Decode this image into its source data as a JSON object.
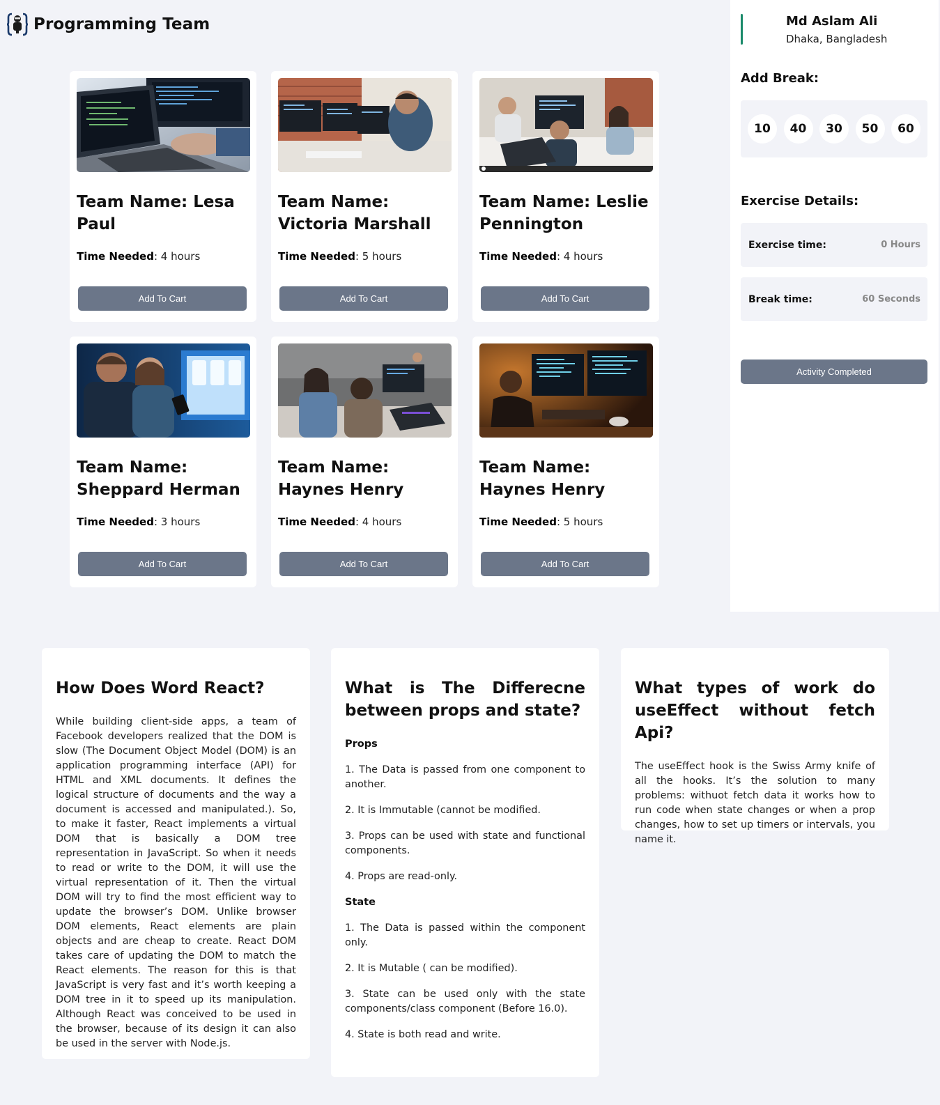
{
  "header": {
    "title": "Programming Team",
    "logo_icon": "bracket-robot-logo-icon"
  },
  "cards": [
    {
      "title": "Team Name: Lesa Paul",
      "time_label": "Time Needed",
      "time_value": ": 4 hours",
      "button": "Add To Cart",
      "image": "laptop-coding-photo"
    },
    {
      "title": "Team Name: Victoria Marshall",
      "time_label": "Time Needed",
      "time_value": ": 5 hours",
      "button": "Add To Cart",
      "image": "developer-monitors-photo"
    },
    {
      "title": "Team Name: Leslie Pennington",
      "time_label": "Time Needed",
      "time_value": ": 4 hours",
      "button": "Add To Cart",
      "image": "team-meeting-photo"
    },
    {
      "title": "Team Name: Sheppard Herman",
      "time_label": "Time Needed",
      "time_value": ": 3 hours",
      "button": "Add To Cart",
      "image": "app-design-photo"
    },
    {
      "title": "Team Name: Haynes Henry",
      "time_label": "Time Needed",
      "time_value": ": 4 hours",
      "button": "Add To Cart",
      "image": "office-coworkers-photo"
    },
    {
      "title": "Team Name: Haynes Henry",
      "time_label": "Time Needed",
      "time_value": ": 5 hours",
      "button": "Add To Cart",
      "image": "night-coding-photo"
    }
  ],
  "sidebar": {
    "name": "Md Aslam Ali",
    "location": "Dhaka, Bangladesh",
    "add_break_title": "Add Break:",
    "breaks": [
      "10",
      "40",
      "30",
      "50",
      "60"
    ],
    "exercise_title": "Exercise Details:",
    "exercise_time_label": "Exercise time:",
    "exercise_time_value": "0 Hours",
    "break_time_label": "Break time:",
    "break_time_value": "60 Seconds",
    "completed_button": "Activity Completed"
  },
  "qa": {
    "q1": {
      "title": "How Does Word React?",
      "body": "While building client-side apps, a team of Facebook developers realized that the DOM is slow (The Document Object Model (DOM) is an application programming interface (API) for HTML and XML documents. It defines the logical structure of documents and the way a document is accessed and manipulated.). So, to make it faster, React implements a virtual DOM that is basically a DOM tree representation in JavaScript. So when it needs to read or write to the DOM, it will use the virtual representation of it. Then the virtual DOM will try to find the most efficient way to update the browser’s DOM. Unlike browser DOM elements, React elements are plain objects and are cheap to create. React DOM takes care of updating the DOM to match the React elements. The reason for this is that JavaScript is very fast and it’s worth keeping a DOM tree in it to speed up its manipulation. Although React was conceived to be used in the browser, because of its design it can also be used in the server with Node.js."
    },
    "q2": {
      "title": "What is The Differecne between props and state?",
      "props_head": "Props",
      "props": [
        "1. The Data is passed from one component to another.",
        "2. It is Immutable (cannot be modified.",
        "3. Props can be used with state and functional components.",
        "4. Props are read-only."
      ],
      "state_head": "State",
      "state": [
        "1. The Data is passed within the component only.",
        "2. It is Mutable ( can be modified).",
        "3. State can be used only with the state components/class component (Before 16.0).",
        "4. State is both read and write."
      ]
    },
    "q3": {
      "title": "What types of work do useEffect without fetch Api?",
      "body": "The useEffect hook is the Swiss Army knife of all the hooks. It’s the solution to many problems: withuot fetch data it works how to run code when state changes or when a prop changes, how to set up timers or intervals, you name it."
    }
  }
}
